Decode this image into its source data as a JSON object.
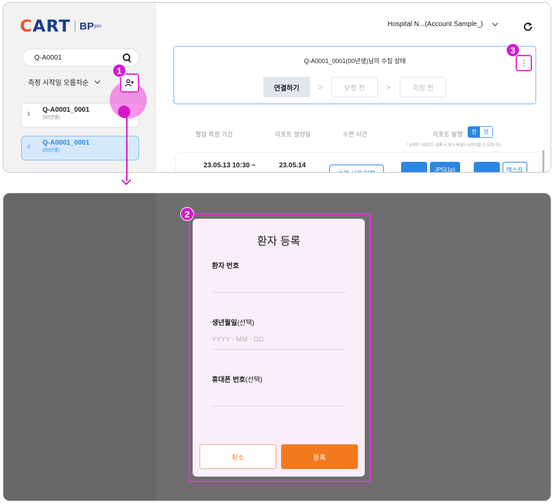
{
  "logo": {
    "brand": "CART",
    "product": "BP",
    "tier": "pro"
  },
  "sidebar": {
    "search_value": "Q-A0001",
    "sort_label": "측정 시작일 오름차순",
    "patients": [
      {
        "index": "1",
        "name": "Q-A0001_0001",
        "sub": "(00년생)"
      },
      {
        "index": "2",
        "name": "Q-A0001_0001",
        "sub": "(00년생)"
      }
    ]
  },
  "header": {
    "account": "Hospital N...(Account Sample_)"
  },
  "status": {
    "title": "Q-A0001_0001(00년생)님의 수집 상태",
    "steps": [
      "연결하기",
      "보정 전",
      "측정 전"
    ],
    "step_separator": ">"
  },
  "table": {
    "headers": [
      "혈압 측정 기간",
      "리포트 생성일",
      "수면 시간",
      "리포트 발행"
    ],
    "lang_on": "한",
    "lang_off": "영",
    "report_note": "* 리포트 다운로드 실패 시 임시 파일이 남아있을 수 있습니다.",
    "row": {
      "period": "23.05.13  10:30 ~",
      "created": "23.05.14",
      "sleep_button": "수면 시간 입력",
      "jpg_button": "JPG(1p)",
      "text_button": "텍스트"
    }
  },
  "annotations": {
    "badge1": "1",
    "badge2": "2",
    "badge3": "3"
  },
  "modal": {
    "title": "환자 등록",
    "patient_number_label": "환자 번호",
    "birth_label": "생년월일",
    "birth_optional": "(선택)",
    "birth_placeholder": "YYYY - MM - DD",
    "phone_label": "휴대폰 번호",
    "phone_optional": "(선택)",
    "cancel": "취소",
    "submit": "등록"
  },
  "colors": {
    "accent_blue": "#2c86e3",
    "highlight_magenta": "#e233d6",
    "primary_orange": "#f27a1c"
  }
}
